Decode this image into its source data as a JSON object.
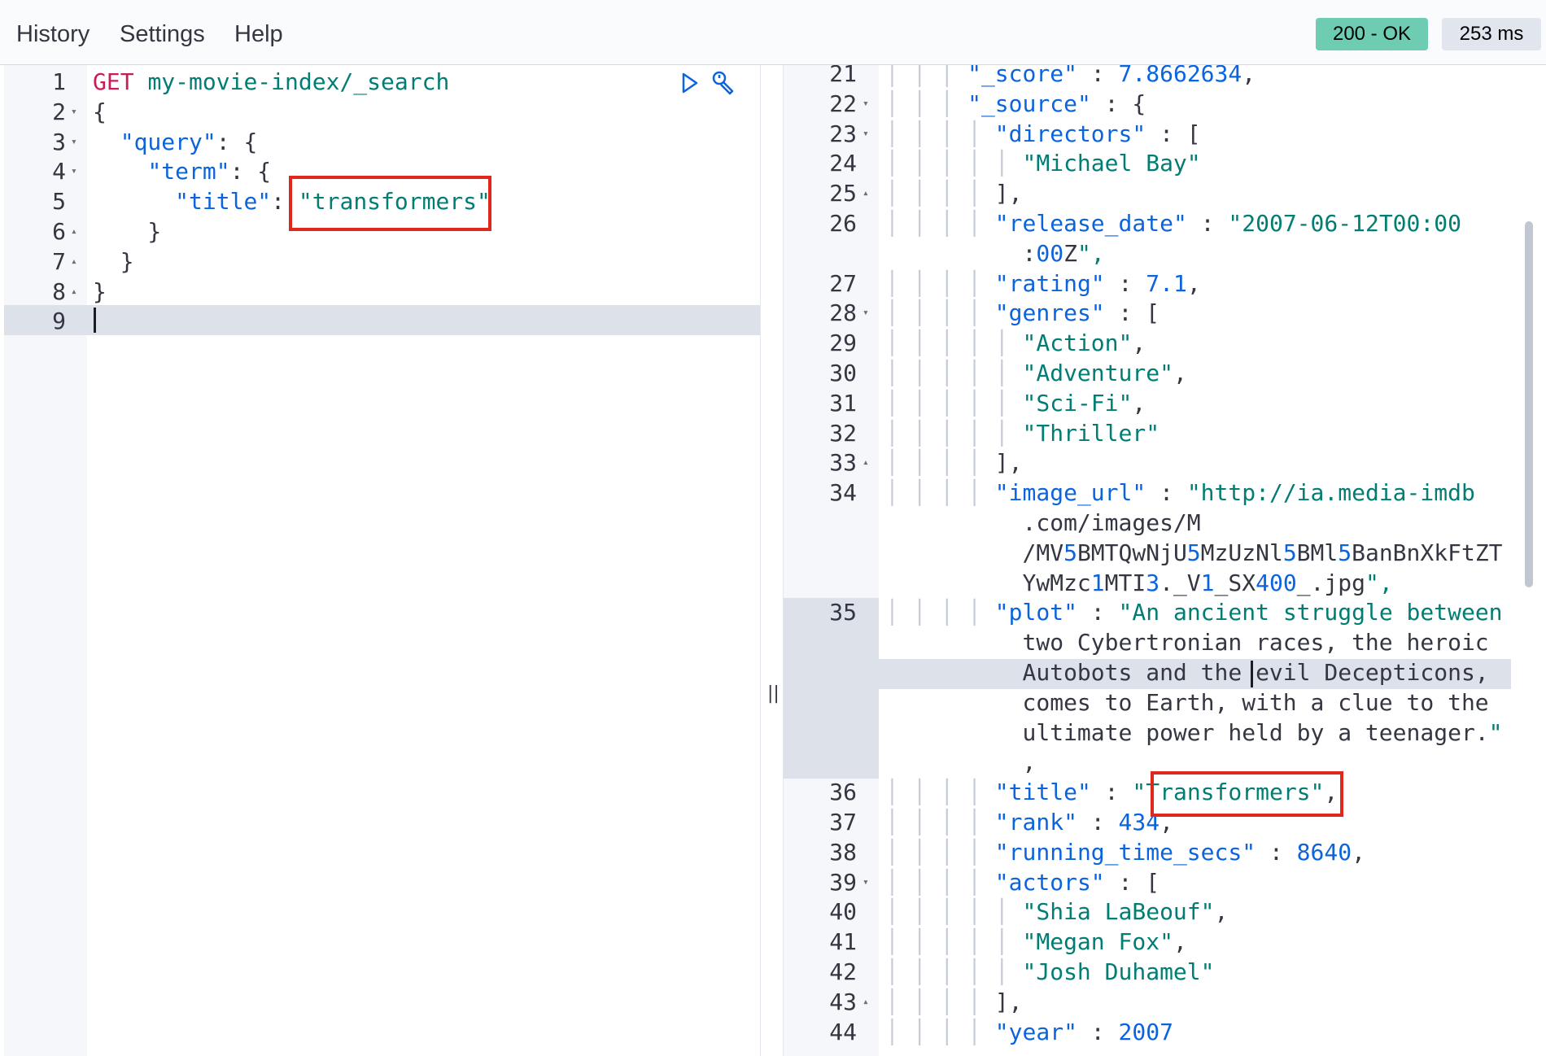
{
  "menu": {
    "items": [
      {
        "label": "History"
      },
      {
        "label": "Settings"
      },
      {
        "label": "Help"
      }
    ]
  },
  "status": {
    "code": "200 - OK",
    "time": "253 ms",
    "code_color": "#6dccb1"
  },
  "request": {
    "lines": [
      {
        "num": "1",
        "fold": "",
        "code": "GET my-movie-index/_search"
      },
      {
        "num": "2",
        "fold": "▾",
        "code": "{"
      },
      {
        "num": "3",
        "fold": "▾",
        "code": "  \"query\": {"
      },
      {
        "num": "4",
        "fold": "▾",
        "code": "    \"term\": {"
      },
      {
        "num": "5",
        "fold": "",
        "code": "      \"title\": \"transformers\""
      },
      {
        "num": "6",
        "fold": "▴",
        "code": "    }"
      },
      {
        "num": "7",
        "fold": "▴",
        "code": "  }"
      },
      {
        "num": "8",
        "fold": "▴",
        "code": "}"
      },
      {
        "num": "9",
        "fold": "",
        "code": ""
      }
    ],
    "run_icon": "play-icon",
    "settings_icon": "wrench-icon"
  },
  "response": {
    "lines": [
      {
        "num": "21",
        "fold": "",
        "guides": "| | | ",
        "code": "\"_score\" : 7.8662634,"
      },
      {
        "num": "22",
        "fold": "▾",
        "guides": "| | | ",
        "code": "\"_source\" : {"
      },
      {
        "num": "23",
        "fold": "▾",
        "guides": "| | | | ",
        "code": "\"directors\" : ["
      },
      {
        "num": "24",
        "fold": "",
        "guides": "| | | | | ",
        "code": "\"Michael Bay\""
      },
      {
        "num": "25",
        "fold": "▴",
        "guides": "| | | | ",
        "code": "],"
      },
      {
        "num": "26",
        "fold": "",
        "guides": "| | | | ",
        "code": "\"release_date\" : \"2007-06-12T00:00"
      },
      {
        "num": "",
        "fold": "",
        "guides": "",
        "code": ":00Z\","
      },
      {
        "num": "27",
        "fold": "",
        "guides": "| | | | ",
        "code": "\"rating\" : 7.1,"
      },
      {
        "num": "28",
        "fold": "▾",
        "guides": "| | | | ",
        "code": "\"genres\" : ["
      },
      {
        "num": "29",
        "fold": "",
        "guides": "| | | | | ",
        "code": "\"Action\","
      },
      {
        "num": "30",
        "fold": "",
        "guides": "| | | | | ",
        "code": "\"Adventure\","
      },
      {
        "num": "31",
        "fold": "",
        "guides": "| | | | | ",
        "code": "\"Sci-Fi\","
      },
      {
        "num": "32",
        "fold": "",
        "guides": "| | | | | ",
        "code": "\"Thriller\""
      },
      {
        "num": "33",
        "fold": "▴",
        "guides": "| | | | ",
        "code": "],"
      },
      {
        "num": "34",
        "fold": "",
        "guides": "| | | | ",
        "code": "\"image_url\" : \"http://ia.media-imdb"
      },
      {
        "num": "",
        "fold": "",
        "guides": "",
        "code": ".com/images/M"
      },
      {
        "num": "",
        "fold": "",
        "guides": "",
        "code": "/MV5BMTQwNjU5MzUzNl5BMl5BanBnXkFtZT"
      },
      {
        "num": "",
        "fold": "",
        "guides": "",
        "code": "YwMzc1MTI3._V1_SX400_.jpg\","
      },
      {
        "num": "35",
        "fold": "",
        "guides": "| | | | ",
        "code": "\"plot\" : \"An ancient struggle between"
      },
      {
        "num": "",
        "fold": "",
        "guides": "",
        "code": "two Cybertronian races, the heroic"
      },
      {
        "num": "",
        "fold": "",
        "guides": "",
        "code": "Autobots and the evil Decepticons,"
      },
      {
        "num": "",
        "fold": "",
        "guides": "",
        "code": "comes to Earth, with a clue to the"
      },
      {
        "num": "",
        "fold": "",
        "guides": "",
        "code": "ultimate power held by a teenager.\""
      },
      {
        "num": "",
        "fold": "",
        "guides": "",
        "code": ","
      },
      {
        "num": "36",
        "fold": "",
        "guides": "| | | | ",
        "code": "\"title\" : \"Transformers\","
      },
      {
        "num": "37",
        "fold": "",
        "guides": "| | | | ",
        "code": "\"rank\" : 434,"
      },
      {
        "num": "38",
        "fold": "",
        "guides": "| | | | ",
        "code": "\"running_time_secs\" : 8640,"
      },
      {
        "num": "39",
        "fold": "▾",
        "guides": "| | | | ",
        "code": "\"actors\" : ["
      },
      {
        "num": "40",
        "fold": "",
        "guides": "| | | | | ",
        "code": "\"Shia LaBeouf\","
      },
      {
        "num": "41",
        "fold": "",
        "guides": "| | | | | ",
        "code": "\"Megan Fox\","
      },
      {
        "num": "42",
        "fold": "",
        "guides": "| | | | | ",
        "code": "\"Josh Duhamel\""
      },
      {
        "num": "43",
        "fold": "▴",
        "guides": "| | | | ",
        "code": "],"
      },
      {
        "num": "44",
        "fold": "",
        "guides": "| | | | ",
        "code": "\"year\" : 2007"
      }
    ]
  },
  "divider": {
    "icon": "drag-handle-icon",
    "glyph": "||"
  }
}
